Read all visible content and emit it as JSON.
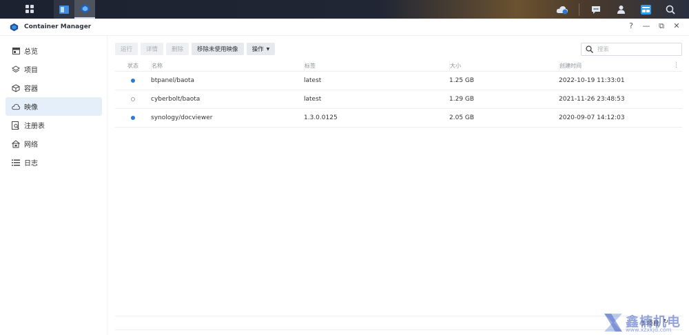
{
  "app": {
    "title": "Container Manager"
  },
  "window_controls": {
    "help": "?",
    "minimize": "—",
    "restore": "⧉",
    "close": "✕"
  },
  "sidebar": {
    "items": [
      {
        "label": "总览",
        "icon": "overview-icon",
        "active": false
      },
      {
        "label": "项目",
        "icon": "layers-icon",
        "active": false
      },
      {
        "label": "容器",
        "icon": "box-icon",
        "active": false
      },
      {
        "label": "映像",
        "icon": "cloud-icon",
        "active": true
      },
      {
        "label": "注册表",
        "icon": "registry-search-icon",
        "active": false
      },
      {
        "label": "网络",
        "icon": "network-house-icon",
        "active": false
      },
      {
        "label": "日志",
        "icon": "list-icon",
        "active": false
      }
    ]
  },
  "toolbar": {
    "run": "运行",
    "details": "详情",
    "delete": "删除",
    "remove_unused": "移除未使用映像",
    "action": "操作"
  },
  "search": {
    "placeholder": "搜索"
  },
  "table": {
    "headers": {
      "status": "状态",
      "name": "名称",
      "tag": "标签",
      "size": "大小",
      "created": "创建时间"
    },
    "rows": [
      {
        "status": "running",
        "name": "btpanel/baota",
        "tag": "latest",
        "size": "1.25 GB",
        "created": "2022-10-19 11:33:01"
      },
      {
        "status": "stopped",
        "name": "cyberbolt/baota",
        "tag": "latest",
        "size": "1.29 GB",
        "created": "2021-11-26 23:48:53"
      },
      {
        "status": "running",
        "name": "synology/docviewer",
        "tag": "1.3.0.0125",
        "size": "2.05 GB",
        "created": "2020-09-07 14:12:03"
      }
    ]
  },
  "footer": {
    "count": "3 项目"
  },
  "watermark": {
    "text": "鑫楠机电",
    "url": "www.xzxkjd.com"
  },
  "colors": {
    "accent": "#2a7ad6",
    "active_bg": "#e5effa"
  }
}
